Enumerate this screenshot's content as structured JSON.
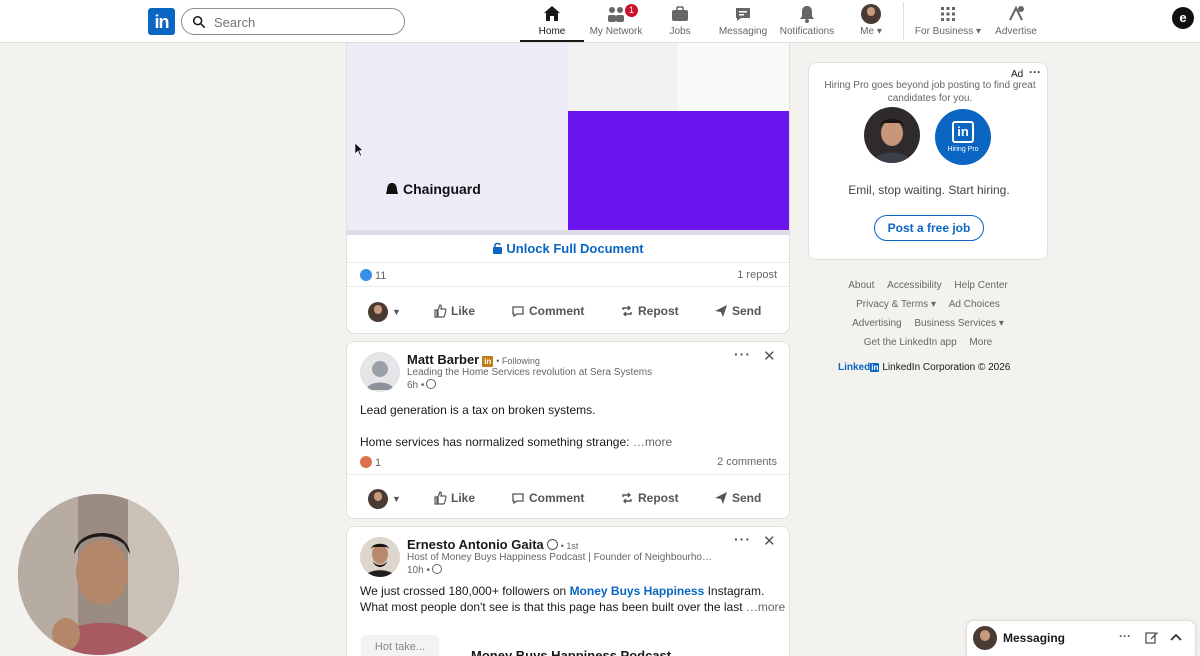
{
  "search": {
    "placeholder": "Search"
  },
  "nav": {
    "items": [
      {
        "label": "Home",
        "icon": "home-icon",
        "active": true
      },
      {
        "label": "My Network",
        "icon": "network-icon",
        "badge": "1"
      },
      {
        "label": "Jobs",
        "icon": "briefcase-icon"
      },
      {
        "label": "Messaging",
        "icon": "chat-icon"
      },
      {
        "label": "Notifications",
        "icon": "bell-icon"
      },
      {
        "label": "Me",
        "icon": "avatar"
      },
      {
        "label": "For Business",
        "icon": "grid-icon"
      },
      {
        "label": "Advertise",
        "icon": "advertise-icon"
      }
    ],
    "extension_letter": "e"
  },
  "logo_text": "in",
  "colors": {
    "brand": "#0a66c2",
    "purple_block": "#6a14f0",
    "badge": "#cb112d"
  },
  "post1": {
    "doc_brand": "Chainguard",
    "unlock_label": "Unlock Full Document",
    "reactions": "11",
    "reposts": "1 repost",
    "actions": {
      "like": "Like",
      "comment": "Comment",
      "repost": "Repost",
      "send": "Send"
    }
  },
  "post2": {
    "author": "Matt Barber",
    "follow_status": "• Following",
    "headline": "Leading the Home Services revolution at Sera Systems",
    "time": "6h •",
    "text_line1": "Lead generation is a tax on broken systems.",
    "text_line2": "Home services has normalized something strange:",
    "more": "…more",
    "reactions": "1",
    "comments": "2 comments",
    "actions": {
      "like": "Like",
      "comment": "Comment",
      "repost": "Repost",
      "send": "Send"
    }
  },
  "post3": {
    "author": "Ernesto Antonio Gaita",
    "degree": "• 1st",
    "headline": "Host of Money Buys Happiness Podcast | Founder of Neighbourho…",
    "time": "10h •",
    "text_line1_pre": "We just crossed 180,000+ followers on ",
    "text_line1_link": "Money Buys Happiness",
    "text_line1_post": " Instagram.",
    "text_line2": "What most people don't see is that this page has been built over the last",
    "more": "…more",
    "image_caption": "Hot take...",
    "image_title": "Money Buys Happiness Podcast"
  },
  "ad": {
    "label": "Ad",
    "description": "Hiring Pro goes beyond job posting to find great candidates for you.",
    "hire_logo": "in",
    "hire_label": "Hiring Pro",
    "headline": "Emil, stop waiting. Start hiring.",
    "cta": "Post a free job"
  },
  "footer": {
    "links": [
      "About",
      "Accessibility",
      "Help Center",
      "Privacy & Terms ▾",
      "Ad Choices",
      "Advertising",
      "Business Services ▾",
      "Get the LinkedIn app",
      "More"
    ],
    "brand_word": "Linked",
    "brand_box": "in",
    "copyright": "LinkedIn Corporation © 2026"
  },
  "messaging": {
    "label": "Messaging"
  }
}
